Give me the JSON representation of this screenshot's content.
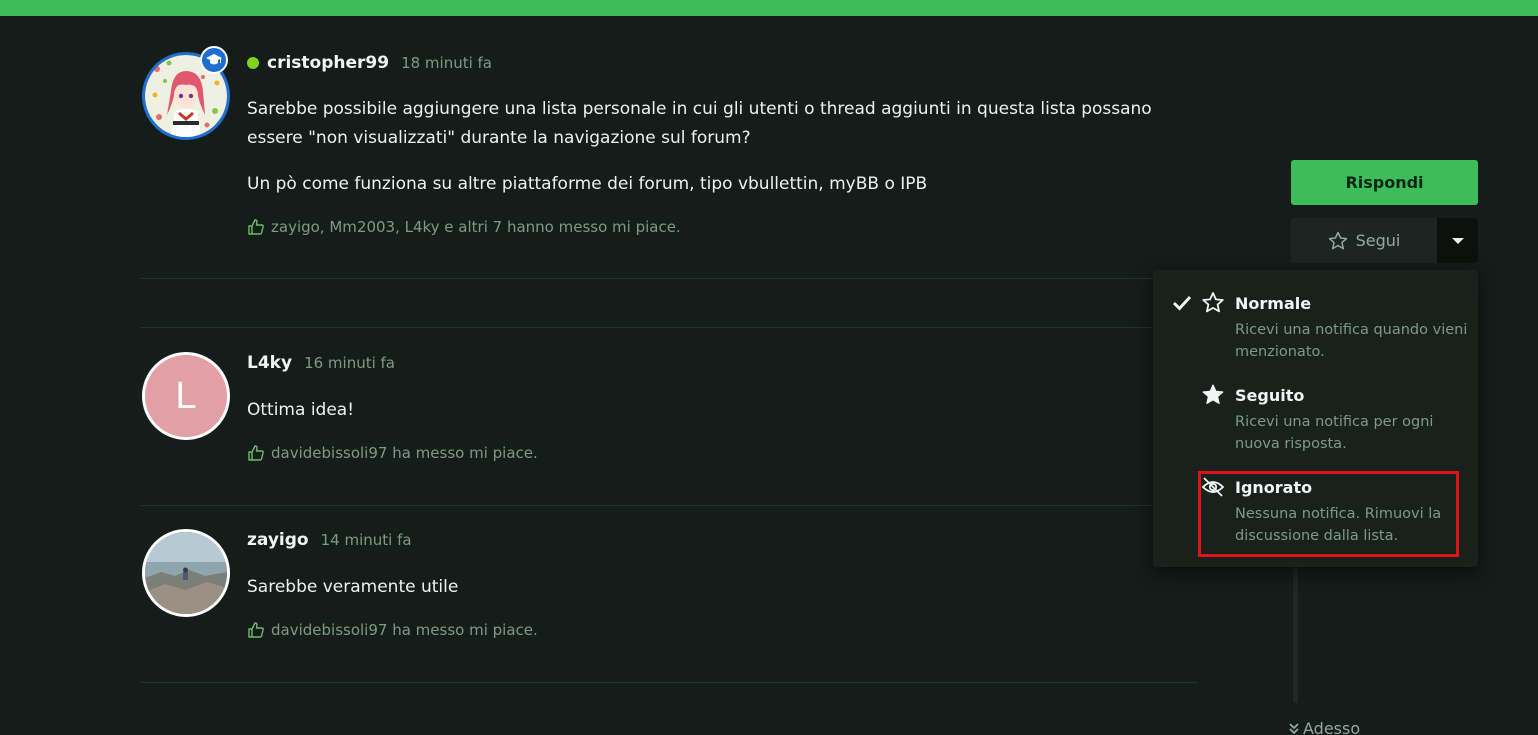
{
  "colors": {
    "accent": "#3dbd5a",
    "background": "#141d19",
    "highlight": "#e0131a",
    "online": "#7ed321"
  },
  "posts": [
    {
      "username": "cristopher99",
      "time": "18 minuti fa",
      "online": true,
      "avatar": "anime-character-image",
      "badge_icon": "graduation-cap-icon",
      "paragraphs": [
        "Sarebbe possibile aggiungere una lista personale in cui gli utenti o thread aggiunti in questa lista possano essere \"non visualizzati\" durante la navigazione sul forum?",
        "Un pò come funziona su altre piattaforme dei forum, tipo vbullettin, myBB o IPB"
      ],
      "likes": "zayigo, Mm2003, L4ky e altri 7 hanno messo mi piace."
    },
    {
      "username": "L4ky",
      "time": "16 minuti fa",
      "avatar_letter": "L",
      "paragraphs": [
        "Ottima idea!"
      ],
      "likes": "davidebissoli97 ha messo mi piace."
    },
    {
      "username": "zayigo",
      "time": "14 minuti fa",
      "avatar": "seaside-photo",
      "paragraphs": [
        "Sarebbe veramente utile"
      ],
      "likes": "davidebissoli97 ha messo mi piace."
    }
  ],
  "sidebar": {
    "reply_label": "Rispondi",
    "follow_label": "Segui",
    "jump_label": "Adesso"
  },
  "follow_menu": {
    "items": [
      {
        "title": "Normale",
        "description": "Ricevi una notifica quando vieni menzionato.",
        "icon": "star-outline-icon",
        "selected": true
      },
      {
        "title": "Seguito",
        "description": "Ricevi una notifica per ogni nuova risposta.",
        "icon": "star-filled-icon",
        "selected": false
      },
      {
        "title": "Ignorato",
        "description": "Nessuna notifica. Rimuovi la discussione dalla lista.",
        "icon": "eye-slash-icon",
        "selected": false,
        "highlighted": true
      }
    ]
  }
}
